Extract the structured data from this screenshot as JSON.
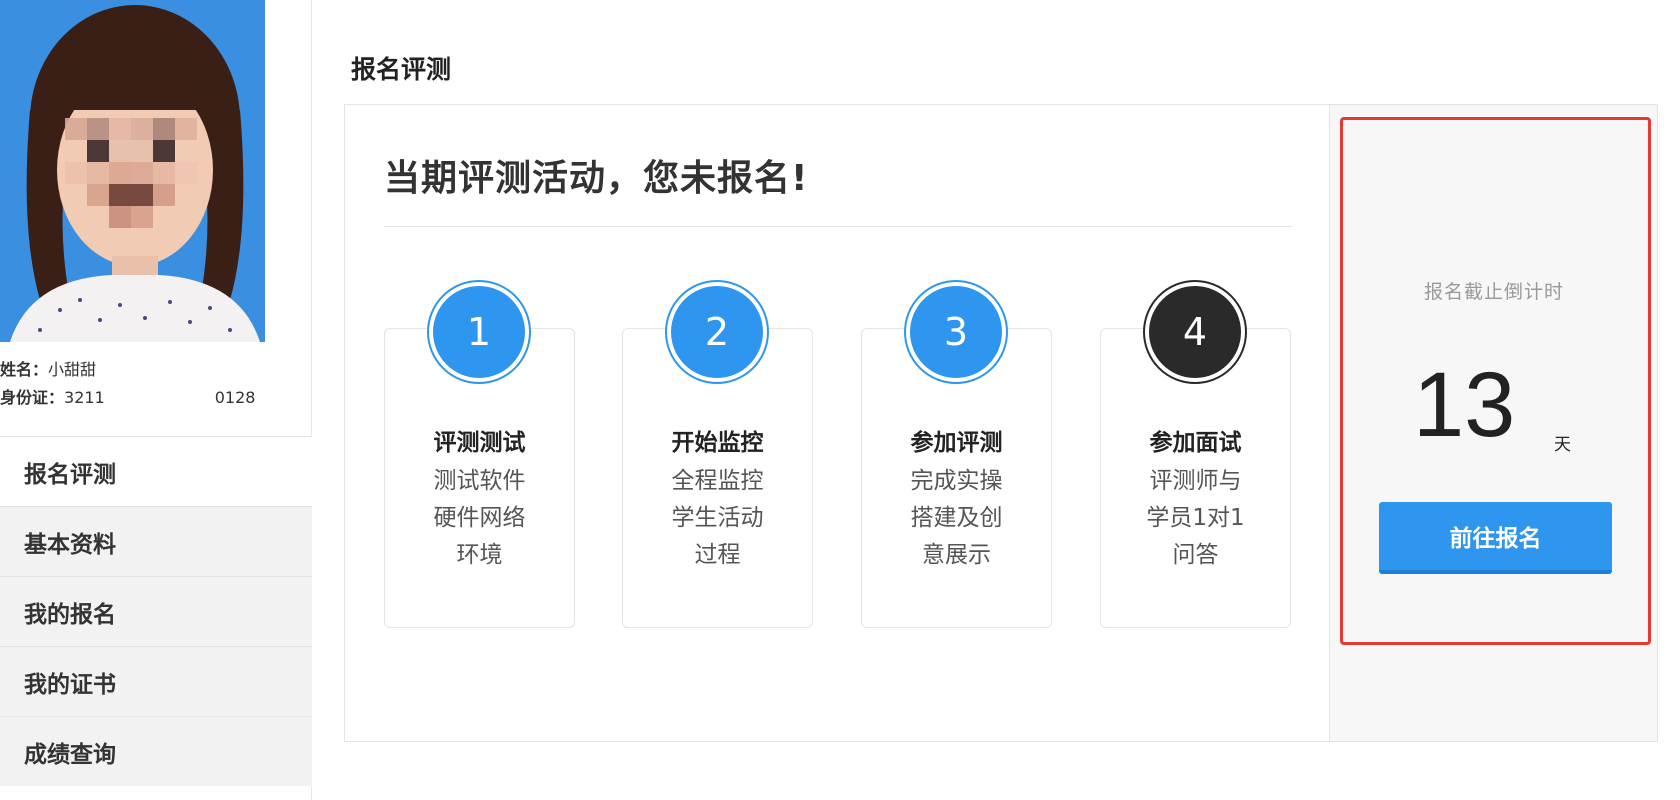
{
  "profile": {
    "name_label": "姓名：",
    "name_value": "小甜甜",
    "id_label": "身份证：",
    "id_value": "3211",
    "id_value_tail": "0128"
  },
  "sidebar": {
    "items": [
      {
        "label": "报名评测",
        "active": true
      },
      {
        "label": "基本资料",
        "active": false
      },
      {
        "label": "我的报名",
        "active": false
      },
      {
        "label": "我的证书",
        "active": false
      },
      {
        "label": "成绩查询",
        "active": false
      }
    ]
  },
  "main": {
    "page_title": "报名评测",
    "headline": "当期评测活动，您未报名!",
    "steps": [
      {
        "number": "1",
        "title": "评测测试",
        "desc": [
          "测试软件",
          "硬件网络",
          "环境"
        ],
        "style": "blue"
      },
      {
        "number": "2",
        "title": "开始监控",
        "desc": [
          "全程监控",
          "学生活动",
          "过程"
        ],
        "style": "blue"
      },
      {
        "number": "3",
        "title": "参加评测",
        "desc": [
          "完成实操",
          "搭建及创",
          "意展示"
        ],
        "style": "blue"
      },
      {
        "number": "4",
        "title": "参加面试",
        "desc": [
          "评测师与",
          "学员1对1",
          "问答"
        ],
        "style": "dark"
      }
    ]
  },
  "countdown": {
    "label": "报名截止倒计时",
    "value": "13",
    "unit": "天",
    "button_label": "前往报名"
  },
  "colors": {
    "accent": "#2f96ef",
    "highlight": "#e53935",
    "dark_step": "#2a2a2a"
  }
}
